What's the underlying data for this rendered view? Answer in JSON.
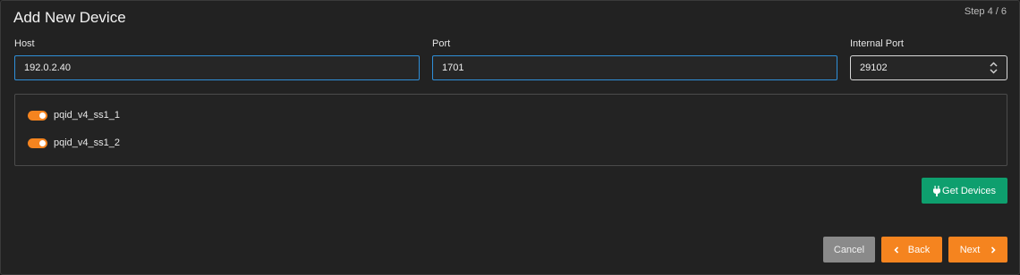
{
  "dialog": {
    "title": "Add New Device",
    "step": "Step 4 / 6"
  },
  "fields": {
    "host": {
      "label": "Host",
      "value": "192.0.2.40"
    },
    "port": {
      "label": "Port",
      "value": "1701"
    },
    "internal_port": {
      "label": "Internal Port",
      "value": "29102"
    }
  },
  "devices": [
    {
      "label": "pqid_v4_ss1_1",
      "enabled": true
    },
    {
      "label": "pqid_v4_ss1_2",
      "enabled": true
    }
  ],
  "actions": {
    "get_devices": {
      "label": "Get Devices",
      "icon": "plug-icon"
    },
    "cancel": {
      "label": "Cancel"
    },
    "back": {
      "label": "Back",
      "icon": "chevron-left-icon"
    },
    "next": {
      "label": "Next",
      "icon": "chevron-right-icon"
    }
  },
  "colors": {
    "accent_orange": "#f5841f",
    "accent_green": "#0e9f6e",
    "focus_blue": "#2f8fd8",
    "neutral_button": "#8a8a8a",
    "background": "#222222"
  }
}
